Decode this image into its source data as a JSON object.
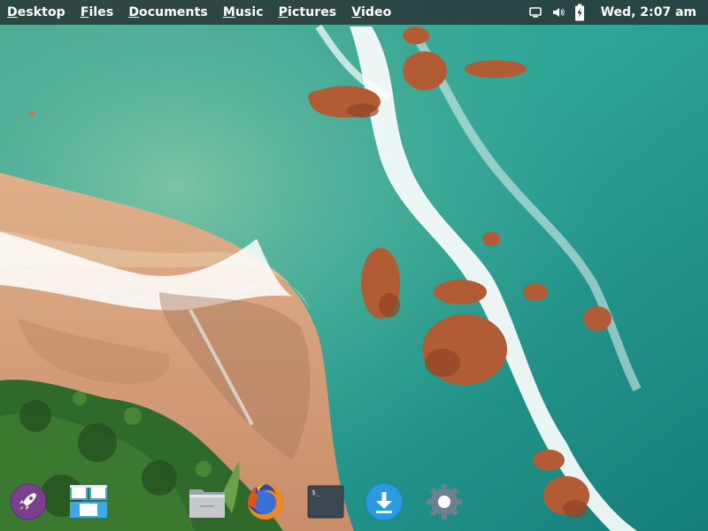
{
  "top_panel": {
    "places": [
      {
        "label": "Desktop",
        "mnemonic": "D",
        "rest": "esktop"
      },
      {
        "label": "Files",
        "mnemonic": "F",
        "rest": "iles"
      },
      {
        "label": "Documents",
        "mnemonic": "D",
        "rest": "ocuments"
      },
      {
        "label": "Music",
        "mnemonic": "M",
        "rest": "usic"
      },
      {
        "label": "Pictures",
        "mnemonic": "P",
        "rest": "ictures"
      },
      {
        "label": "Video",
        "mnemonic": "V",
        "rest": "ideo"
      }
    ],
    "indicators": {
      "display": "display-icon",
      "sound": "speaker-volume-icon",
      "battery": "battery-charging-icon"
    },
    "clock": "Wed,  2:07 am"
  },
  "dock": {
    "items": [
      {
        "name": "launcher",
        "icon": "rocket-icon",
        "color": "#7a3f8e"
      },
      {
        "name": "multitasking",
        "icon": "multitasking-view-icon",
        "color": "#3ea8e5"
      },
      {
        "name": "files",
        "icon": "folder-icon",
        "color": "#c5c9cc"
      },
      {
        "name": "firefox",
        "icon": "firefox-icon",
        "color": "#f08a1c"
      },
      {
        "name": "terminal",
        "icon": "terminal-icon",
        "color": "#3b4650"
      },
      {
        "name": "downloads",
        "icon": "download-icon",
        "color": "#2a9be0"
      },
      {
        "name": "settings",
        "icon": "gear-icon",
        "color": "#6e7f8d"
      }
    ],
    "terminal_prompt": "$_"
  },
  "wallpaper": {
    "description_colors": {
      "sea": "#1f9a8c",
      "shallow": "#58b49a",
      "sand": "#d9a27a",
      "rocks": "#b4623a",
      "foliage": "#2f6a2a",
      "foam": "#ffffff"
    }
  }
}
